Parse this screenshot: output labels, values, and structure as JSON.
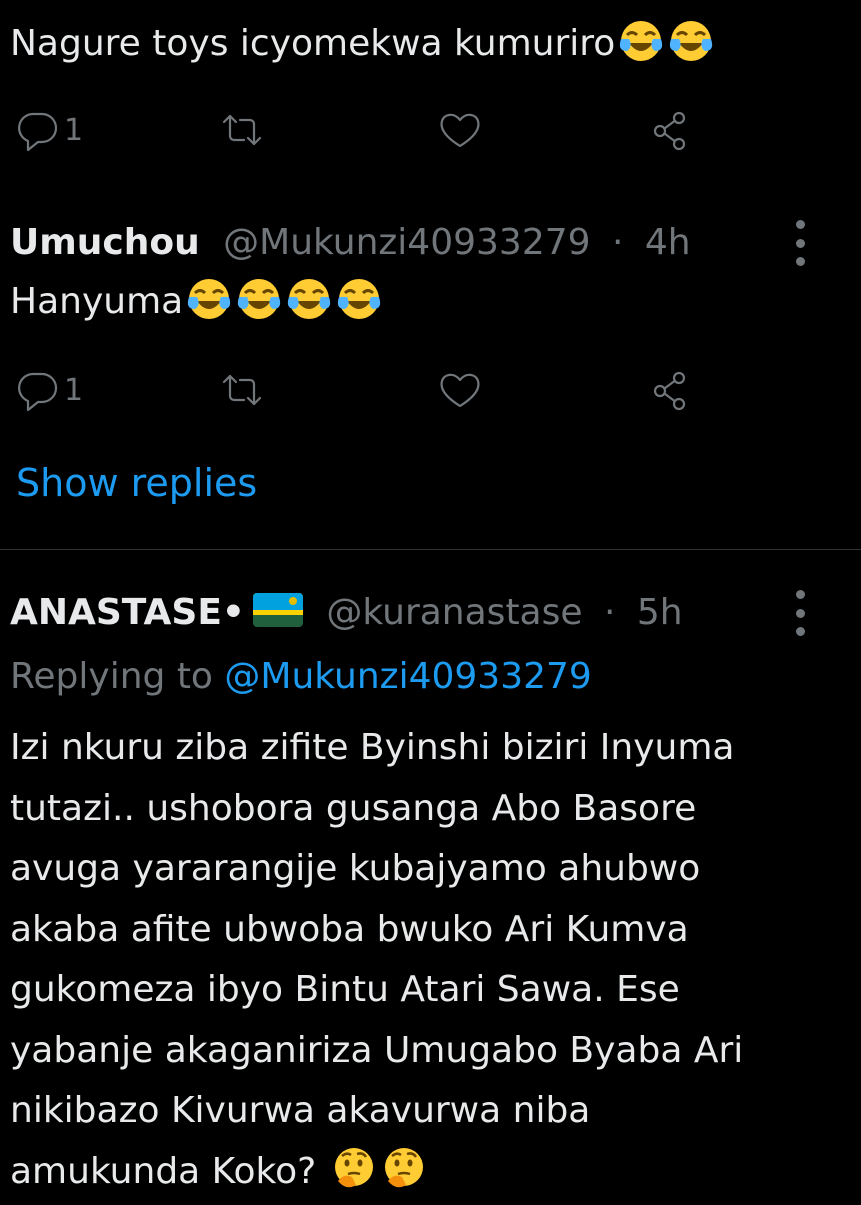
{
  "tweets": [
    {
      "text": "Nagure toys icyomekwa kumuriro",
      "emojis": [
        "tears-of-joy",
        "tears-of-joy"
      ],
      "reply_count": "1"
    },
    {
      "name": "Umuchou",
      "handle": "@Mukunzi40933279",
      "separator": "·",
      "time": "4h",
      "text": "Hanyuma",
      "emojis": [
        "tears-of-joy",
        "tears-of-joy",
        "tears-of-joy",
        "tears-of-joy"
      ],
      "reply_count": "1"
    }
  ],
  "show_replies_label": "Show replies",
  "reply": {
    "name": "ANASTASE•",
    "flag": "rwanda-flag",
    "handle": "@kuranastase",
    "separator": "·",
    "time": "5h",
    "replying_prefix": "Replying to",
    "replying_mention": "@Mukunzi40933279",
    "body_lines": [
      "Izi nkuru ziba zifite Byinshi biziri Inyuma",
      "tutazi.. ushobora gusanga Abo Basore",
      "avuga yararangije kubajyamo ahubwo",
      "akaba afite ubwoba bwuko Ari Kumva",
      "gukomeza ibyo Bintu Atari Sawa. Ese",
      "yabanje akaganiriza Umugabo Byaba Ari",
      "nikibazo Kivurwa akavurwa niba",
      "amukunda Koko?"
    ],
    "trailing_emojis": [
      "thinking-face",
      "thinking-face"
    ]
  },
  "colors": {
    "background": "#000000",
    "text": "#e7e9ea",
    "muted": "#71767b",
    "accent": "#1d9bf0",
    "divider": "#2f3336"
  }
}
